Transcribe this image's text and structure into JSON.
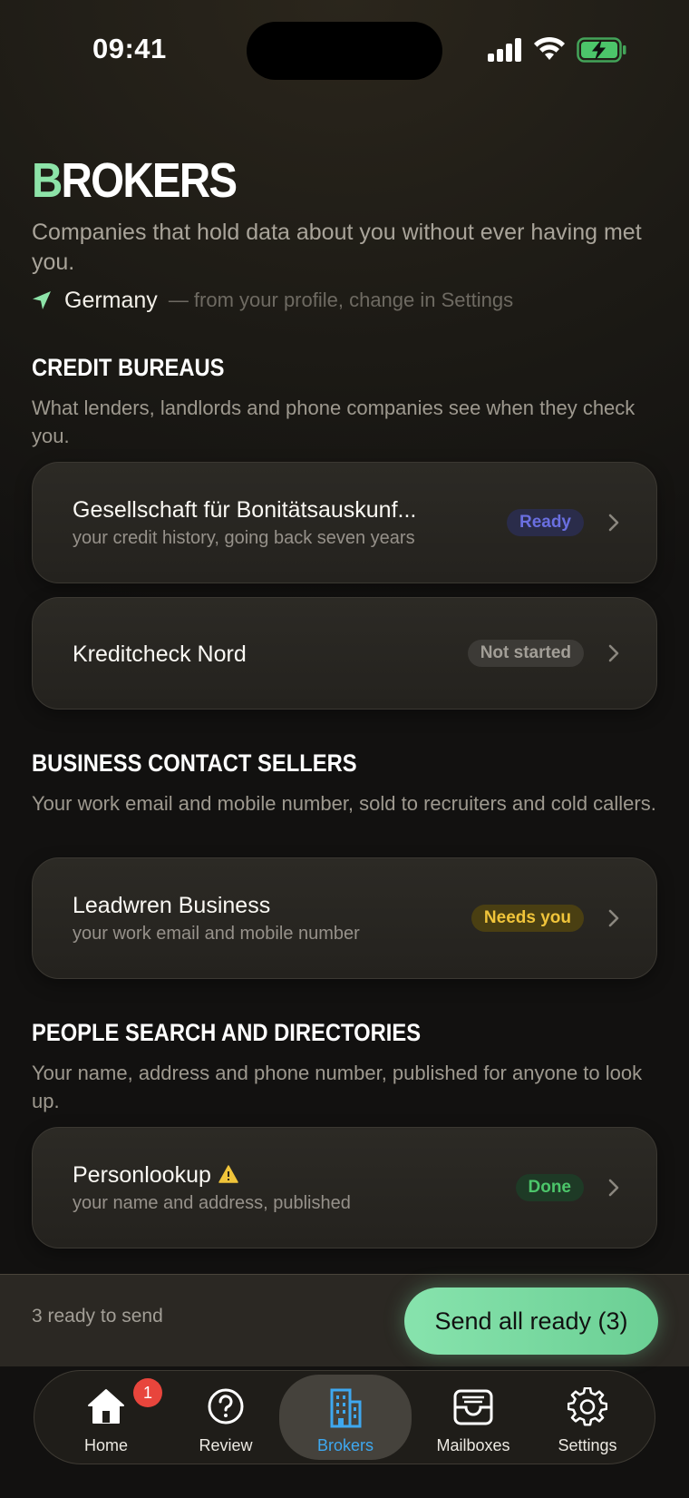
{
  "status_bar": {
    "time": "09:41"
  },
  "header": {
    "title_first": "B",
    "title_rest": "ROKERS",
    "subtitle": "Companies that hold data about you without ever having met you.",
    "location": "Germany",
    "location_note": "— from your profile, change in Settings"
  },
  "sections": [
    {
      "title": "CREDIT BUREAUS",
      "description": "What lenders, landlords and phone companies see when they check you.",
      "items": [
        {
          "name": "Gesellschaft für Bonitätsauskunf...",
          "description": "your credit history, going back seven years",
          "status": "Ready"
        },
        {
          "name": "Kreditcheck Nord",
          "description": "",
          "status": "Not started"
        }
      ]
    },
    {
      "title": "BUSINESS CONTACT SELLERS",
      "description": "Your work email and mobile number, sold to recruiters and cold callers.",
      "items": [
        {
          "name": "Leadwren Business",
          "description": "your work email and mobile number",
          "status": "Needs you"
        }
      ]
    },
    {
      "title": "PEOPLE SEARCH AND DIRECTORIES",
      "description": "Your name, address and phone number, published for anyone to look up.",
      "items": [
        {
          "name": "Personlookup",
          "description": "your name and address, published",
          "status": "Done",
          "warning": true
        }
      ]
    }
  ],
  "send_bar": {
    "count_text": "3 ready to send",
    "button_label": "Send all ready (3)"
  },
  "tabs": [
    {
      "label": "Home",
      "icon": "home-icon",
      "badge": "1"
    },
    {
      "label": "Review",
      "icon": "question-circle-icon"
    },
    {
      "label": "Brokers",
      "icon": "building-icon",
      "active": true
    },
    {
      "label": "Mailboxes",
      "icon": "inbox-icon"
    },
    {
      "label": "Settings",
      "icon": "gear-icon"
    }
  ],
  "colors": {
    "accent_green": "#8de3a8",
    "ready": "#6a6fe0",
    "needs_you": "#f0c43a",
    "done": "#4cc56a",
    "active_tab": "#3ea8f0",
    "notification": "#e8453c"
  }
}
